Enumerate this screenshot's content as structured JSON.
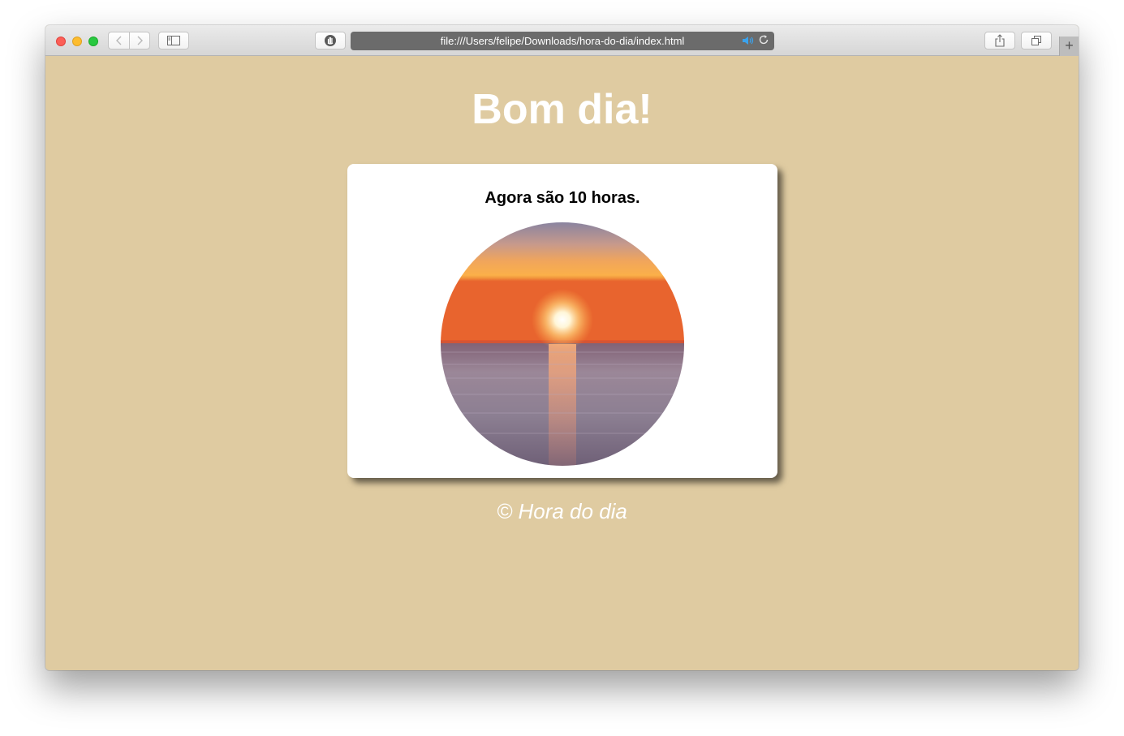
{
  "browser": {
    "url": "file:///Users/felipe/Downloads/hora-do-dia/index.html",
    "icons": {
      "back": "chevron-left-icon",
      "forward": "chevron-right-icon",
      "sidebar": "sidebar-icon",
      "privacy": "hand-icon",
      "audio": "speaker-icon",
      "reload": "reload-icon",
      "share": "share-icon",
      "tabs": "tabs-icon",
      "new_tab": "plus-icon"
    },
    "colors": {
      "close": "#fc5f57",
      "minimize": "#fdbc2e",
      "maximize": "#28c840"
    }
  },
  "page": {
    "heading": "Bom dia!",
    "time_text": "Agora são 10 horas.",
    "footer": "© Hora do dia",
    "background_color": "#dfcba1"
  }
}
